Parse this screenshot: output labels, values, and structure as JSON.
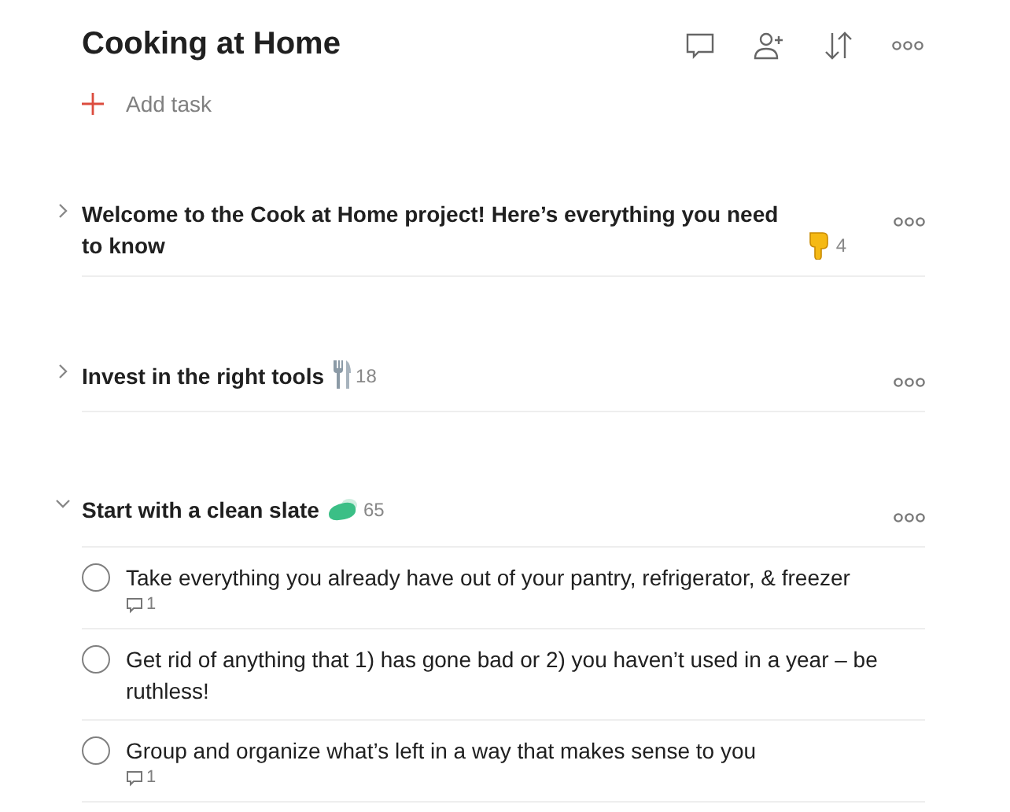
{
  "project": {
    "title": "Cooking at Home"
  },
  "add_task": {
    "label": "Add task"
  },
  "sections": [
    {
      "title": "Welcome to the Cook at Home project! Here’s everything you need to know",
      "count": "4",
      "expanded": false
    },
    {
      "title": "Invest in the right tools",
      "count": "18",
      "expanded": false
    },
    {
      "title": "Start with a clean slate",
      "count": "65",
      "expanded": true,
      "tasks": [
        {
          "text": "Take everything you already have out of your pantry, refrigerator, & freezer",
          "checked": false,
          "comments": "1"
        },
        {
          "text": "Get rid of anything that 1) has gone bad or 2) you haven’t used in a year – be ruthless!",
          "checked": false
        },
        {
          "text": "Group and organize what’s left in a way that makes sense to you",
          "checked": false,
          "comments": "1"
        }
      ]
    }
  ]
}
